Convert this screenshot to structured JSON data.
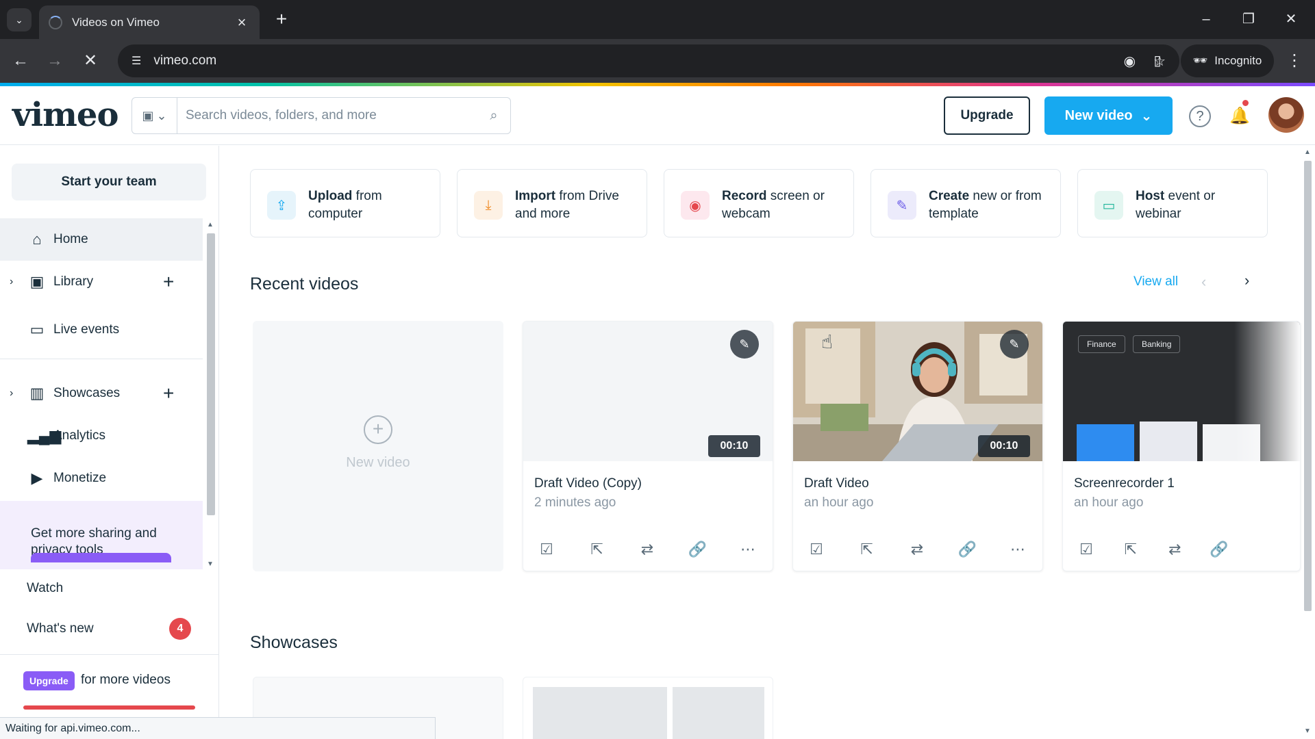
{
  "browser": {
    "tab_title": "Videos on Vimeo",
    "url": "vimeo.com",
    "profile_label": "Incognito"
  },
  "header": {
    "logo": "vimeo",
    "search_placeholder": "Search videos, folders, and more",
    "upgrade_label": "Upgrade",
    "new_video_label": "New video"
  },
  "sidebar": {
    "team_button": "Start your team",
    "items": [
      {
        "label": "Home",
        "icon": "home-icon"
      },
      {
        "label": "Library",
        "icon": "library-icon"
      },
      {
        "label": "Live events",
        "icon": "camera-icon"
      },
      {
        "label": "Showcases",
        "icon": "showcases-icon"
      },
      {
        "label": "Analytics",
        "icon": "analytics-icon"
      },
      {
        "label": "Monetize",
        "icon": "monetize-icon"
      }
    ],
    "promo_text": "Get more sharing and privacy tools",
    "watch_label": "Watch",
    "whats_new_label": "What's new",
    "whats_new_count": "4",
    "upgrade_badge": "Upgrade",
    "upgrade_text": "for more videos"
  },
  "actions": [
    {
      "bold": "Upload",
      "rest": " from computer",
      "icon": "upload-icon",
      "color": "#e6f4fb"
    },
    {
      "bold": "Import",
      "rest": " from Drive and more",
      "icon": "import-icon",
      "color": "#fdf1e4"
    },
    {
      "bold": "Record",
      "rest": " screen or webcam",
      "icon": "record-icon",
      "color": "#fde8ee"
    },
    {
      "bold": "Create",
      "rest": " new or from template",
      "icon": "create-icon",
      "color": "#ecebfb"
    },
    {
      "bold": "Host",
      "rest": " event or webinar",
      "icon": "host-icon",
      "color": "#e4f6f1"
    }
  ],
  "recent": {
    "title": "Recent videos",
    "view_all": "View all",
    "new_video_label": "New video",
    "videos": [
      {
        "title": "Draft Video (Copy)",
        "time": "2 minutes ago",
        "duration": "00:10"
      },
      {
        "title": "Draft Video",
        "time": "an hour ago",
        "duration": "00:10"
      },
      {
        "title": "Screenrecorder 1",
        "time": "an hour ago",
        "chips": [
          "Finance",
          "Banking"
        ]
      }
    ]
  },
  "showcases": {
    "title": "Showcases"
  },
  "status_text": "Waiting for api.vimeo.com..."
}
